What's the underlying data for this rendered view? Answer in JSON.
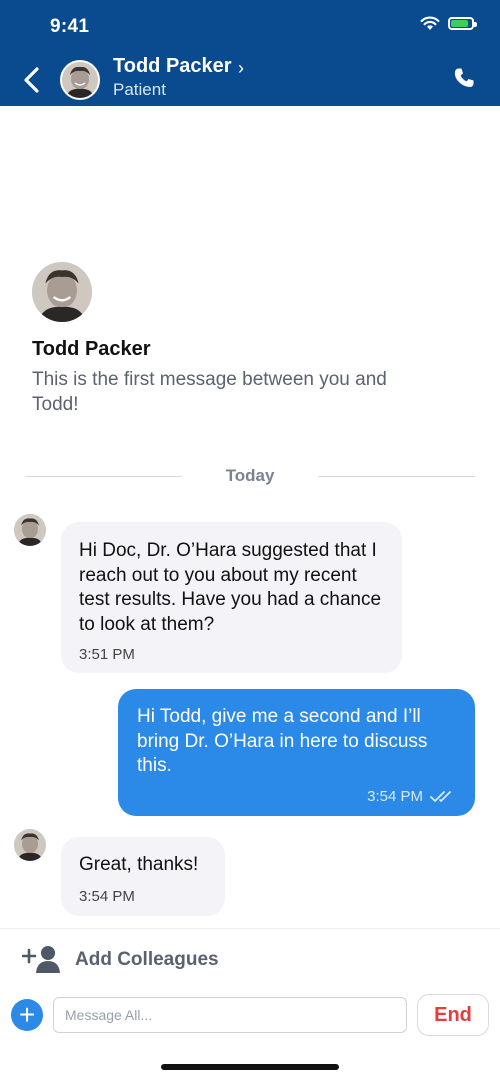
{
  "status": {
    "time": "9:41",
    "battery_level": 0.85
  },
  "header": {
    "name": "Todd Packer",
    "role": "Patient"
  },
  "intro": {
    "name": "Todd Packer",
    "text": "This is the first message between you and Todd!"
  },
  "divider": {
    "label": "Today"
  },
  "messages": [
    {
      "direction": "incoming",
      "text": "Hi Doc, Dr. O’Hara suggested that I reach out to you about my recent test results. Have you had a chance to look at them?",
      "time": "3:51 PM"
    },
    {
      "direction": "outgoing",
      "text": "Hi Todd, give me a second and I’ll bring Dr. O’Hara in here to discuss this.",
      "time": "3:54 PM",
      "read": true
    },
    {
      "direction": "incoming",
      "text": "Great, thanks!",
      "time": "3:54 PM"
    }
  ],
  "add_bar": {
    "label": "Add Colleagues"
  },
  "composer": {
    "placeholder": "Message All...",
    "value": "",
    "end_label": "End"
  },
  "colors": {
    "header_bg": "#0a4a8f",
    "accent": "#2b8ae8",
    "end_red": "#e53c3c"
  },
  "icons": [
    "back-chevron-icon",
    "phone-icon",
    "wifi-icon",
    "battery-icon",
    "add-person-icon",
    "plus-icon",
    "double-check-icon"
  ]
}
